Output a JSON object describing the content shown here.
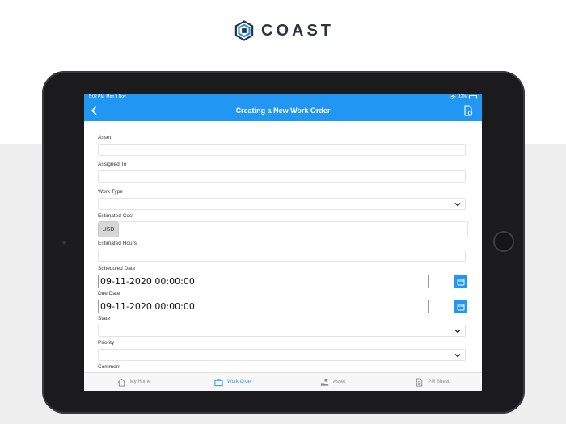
{
  "brand": {
    "name": "COAST",
    "color": "#2b3441",
    "accent": "#2196f3"
  },
  "status": {
    "time": "5:02 PM",
    "date": "Mon 9 Nov",
    "battery": "12%"
  },
  "nav": {
    "title": "Creating a New Work Order",
    "back_icon": "chevron-left-icon",
    "action_icon": "document-settings-icon"
  },
  "form": {
    "asset_label": "Asset",
    "asset_value": "",
    "assigned_label": "Assigned To",
    "assigned_value": "",
    "work_type_label": "Work Type",
    "work_type_value": "",
    "cost_label": "Estimated Cost",
    "currency": "USD",
    "cost_value": "",
    "hours_label": "Estimated Hours",
    "hours_value": "",
    "scheduled_label": "Scheduled Date",
    "scheduled_value": "09-11-2020 00:00:00",
    "due_label": "Due Date",
    "due_value": "09-11-2020 00:00:00",
    "state_label": "State",
    "state_value": "",
    "priority_label": "Priority",
    "priority_value": "",
    "comment_label": "Comment"
  },
  "tabs": [
    {
      "label": "My Home",
      "icon": "home-icon",
      "active": false
    },
    {
      "label": "Work Order",
      "icon": "briefcase-icon",
      "active": true
    },
    {
      "label": "Asset",
      "icon": "asset-hand-icon",
      "active": false
    },
    {
      "label": "PM Sheet",
      "icon": "sheet-icon",
      "active": false
    }
  ]
}
